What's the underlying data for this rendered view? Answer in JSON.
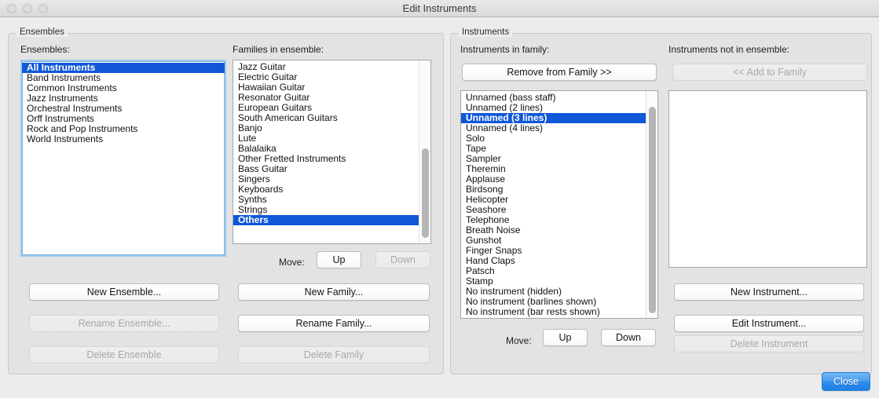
{
  "window": {
    "title": "Edit Instruments",
    "traffic_lights": [
      "close",
      "minimize",
      "zoom"
    ]
  },
  "ensembles_group": {
    "legend": "Ensembles",
    "ensembles_label": "Ensembles:",
    "ensembles_list": {
      "items": [
        "All Instruments",
        "Band Instruments",
        "Common Instruments",
        "Jazz Instruments",
        "Orchestral Instruments",
        "Orff Instruments",
        "Rock and Pop Instruments",
        "World Instruments"
      ],
      "selected_index": 0
    },
    "families_label": "Families in ensemble:",
    "families_list": {
      "items": [
        "Jazz Guitar",
        "Electric Guitar",
        "Hawaiian Guitar",
        "Resonator Guitar",
        "European Guitars",
        "South American Guitars",
        "Banjo",
        "Lute",
        "Balalaika",
        "Other Fretted Instruments",
        "Bass Guitar",
        "Singers",
        "Keyboards",
        "Synths",
        "Strings",
        "Others"
      ],
      "selected_index": 15,
      "scroll_thumb_top_pct": 48,
      "scroll_thumb_height_pct": 49
    },
    "move_label": "Move:",
    "buttons": {
      "move_up": {
        "label": "Up",
        "enabled": true
      },
      "move_down": {
        "label": "Down",
        "enabled": false
      },
      "new_ensemble": {
        "label": "New Ensemble...",
        "enabled": true
      },
      "rename_ensemble": {
        "label": "Rename Ensemble...",
        "enabled": false
      },
      "delete_ensemble": {
        "label": "Delete Ensemble",
        "enabled": false
      },
      "new_family": {
        "label": "New Family...",
        "enabled": true
      },
      "rename_family": {
        "label": "Rename Family...",
        "enabled": true
      },
      "delete_family": {
        "label": "Delete Family",
        "enabled": false
      }
    }
  },
  "instruments_group": {
    "legend": "Instruments",
    "in_family_label": "Instruments in family:",
    "not_in_ensemble_label": "Instruments not in ensemble:",
    "remove_from_family": {
      "label": "Remove from Family >>",
      "enabled": true
    },
    "add_to_family": {
      "label": "<< Add to Family",
      "enabled": false
    },
    "in_family_list": {
      "items": [
        "Unnamed (bass staff)",
        "Unnamed (2 lines)",
        "Unnamed (3 lines)",
        "Unnamed (4 lines)",
        "Solo",
        "Tape",
        "Sampler",
        "Theremin",
        "Applause",
        "Birdsong",
        "Helicopter",
        "Seashore",
        "Telephone",
        "Breath Noise",
        "Gunshot",
        "Finger Snaps",
        "Hand Claps",
        "Patsch",
        "Stamp",
        "No instrument (hidden)",
        "No instrument (barlines shown)",
        "No instrument (bar rests shown)"
      ],
      "selected_index": 2,
      "scroll_thumb_top_pct": 7,
      "scroll_thumb_height_pct": 91
    },
    "not_in_ensemble_list": {
      "items": [],
      "selected_index": -1
    },
    "move_label": "Move:",
    "buttons": {
      "move_up": {
        "label": "Up",
        "enabled": true
      },
      "move_down": {
        "label": "Down",
        "enabled": true
      },
      "new_instrument": {
        "label": "New Instrument...",
        "enabled": true
      },
      "edit_instrument": {
        "label": "Edit Instrument...",
        "enabled": true
      },
      "delete_instrument": {
        "label": "Delete Instrument",
        "enabled": false
      }
    }
  },
  "footer": {
    "close_button": {
      "label": "Close",
      "enabled": true,
      "is_default": true
    }
  },
  "colors": {
    "selection_blue": "#1057d8",
    "default_button_blue": "#2f8ceb",
    "window_background": "#ececec",
    "group_background": "#e3e3e3",
    "list_background": "#ffffff"
  }
}
